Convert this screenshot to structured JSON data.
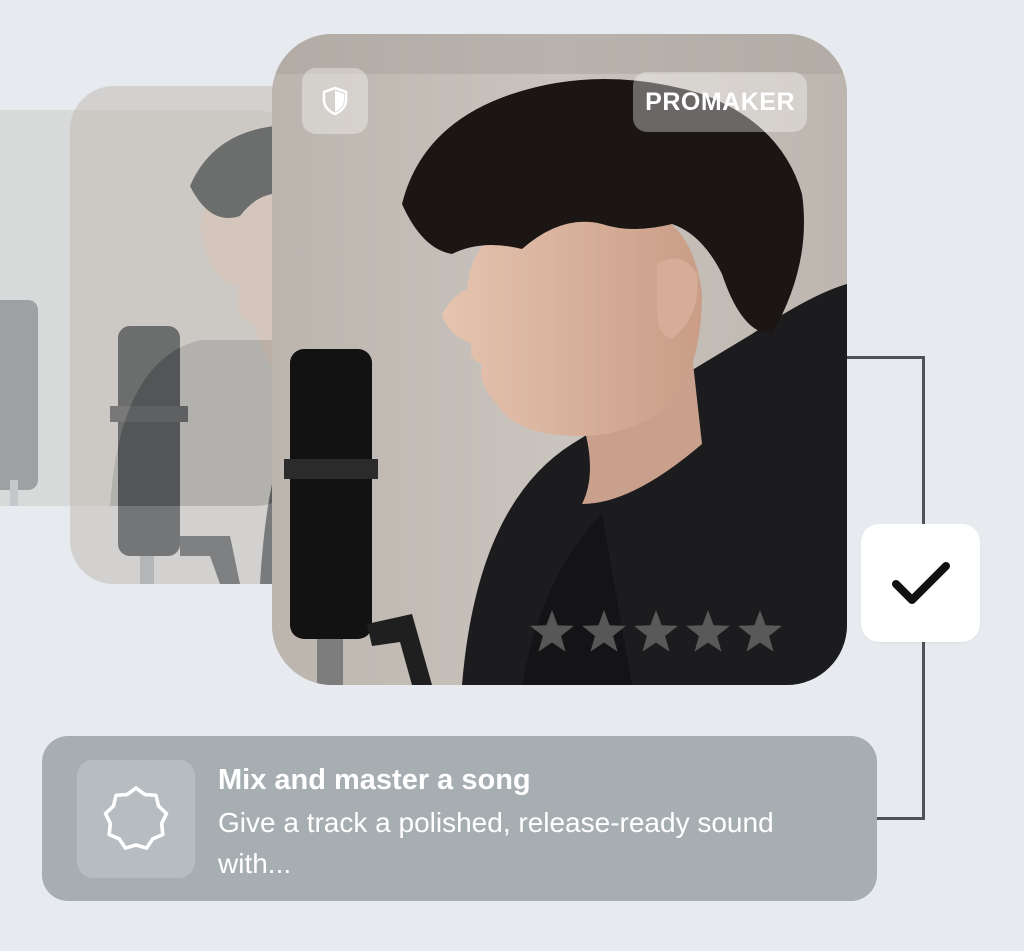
{
  "cards": {
    "brand_label": "PROMAKER",
    "shield_icon": "shield-icon",
    "rating": {
      "stars": 5,
      "icon": "star-icon"
    }
  },
  "check": {
    "icon": "checkmark-icon"
  },
  "task": {
    "icon": "badge-outline-icon",
    "title": "Mix and master a song",
    "description": "Give a track a polished, release-ready sound with..."
  },
  "colors": {
    "background": "#e7ebef",
    "task_card": "#a7aeb1",
    "connector": "#4f5358",
    "check_mark": "#111111"
  }
}
